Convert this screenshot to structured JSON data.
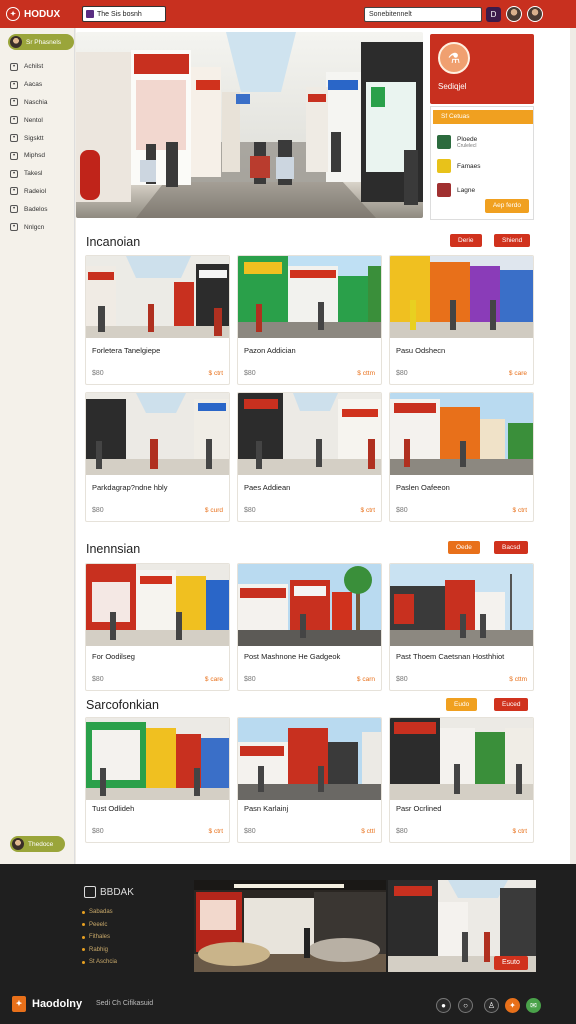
{
  "topbar": {
    "brand": "HODUX",
    "tab_label": "The Sis bosnh",
    "search_value": "Sonebitennelt",
    "btn_label": "D"
  },
  "sidebar": {
    "user_label": "Sr Phasnels",
    "items": [
      "Achilst",
      "Aacas",
      "Naschia",
      "Nentol",
      "Sigsktt",
      "Miphsd",
      "Takesl",
      "Radeiol",
      "Badelos",
      "Nnlgcn"
    ],
    "footer_label": "Thedoce"
  },
  "promo": {
    "title": "Sediqjel",
    "bar_label": "Sf Cetuas",
    "rows": [
      {
        "title": "Ploede",
        "sub": "Crulelecl"
      },
      {
        "title": "Famaes",
        "sub": ""
      },
      {
        "title": "Lagne",
        "sub": ""
      }
    ],
    "button": "Aep ferdo"
  },
  "sections": [
    {
      "title": "Incanoian",
      "buttons": [
        "Derie",
        "Shiend"
      ],
      "cards": [
        {
          "name": "Forletera Tanelgiepe",
          "pa": "$80",
          "pb": "$ ctrt"
        },
        {
          "name": "Pazon Addician",
          "pa": "$80",
          "pb": "$ cttm"
        },
        {
          "name": "Pasu Odshecn",
          "pa": "$80",
          "pb": "$ care"
        },
        {
          "name": "Parkdagrap?ndne hbly",
          "pa": "$80",
          "pb": "$ curd"
        },
        {
          "name": "Paes Addiean",
          "pa": "$80",
          "pb": "$ ctrt"
        },
        {
          "name": "Paslen Oafeeon",
          "pa": "$80",
          "pb": "$ ctrt"
        }
      ]
    },
    {
      "title": "Inennsian",
      "buttons": [
        "Oede",
        "Bacsd"
      ],
      "cards": [
        {
          "name": "For Oodilseg",
          "pa": "$80",
          "pb": "$ care"
        },
        {
          "name": "Post Mashnone He Gadgeok",
          "pa": "$80",
          "pb": "$ carn"
        },
        {
          "name": "Past Thoem Caetsnan Hosthhiot",
          "pa": "$80",
          "pb": "$ cttm"
        }
      ]
    },
    {
      "title": "Sarcofonkian",
      "buttons": [
        "Eudo",
        "Euced"
      ],
      "cards": [
        {
          "name": "Tust Odlideh",
          "pa": "$80",
          "pb": "$ ctrt"
        },
        {
          "name": "Pasn Karlainj",
          "pa": "$80",
          "pb": "$ cttl"
        },
        {
          "name": "Pasr Ocrlined",
          "pa": "$80",
          "pb": "$ ctrt"
        }
      ]
    }
  ],
  "footer": {
    "logo": "BBDAK",
    "links": [
      "Sabadas",
      "Peeelc",
      "Fithales",
      "Rabhig",
      "St Aschcia"
    ],
    "button": "Esuto",
    "brand": "Haodolny",
    "tagline": "Sedi Ch Cifikasuid"
  },
  "colors": {
    "accent_red": "#c8301f",
    "accent_orange": "#e8701a",
    "accent_yellow": "#f0a020",
    "sidebar_olive": "#9aa53a"
  }
}
